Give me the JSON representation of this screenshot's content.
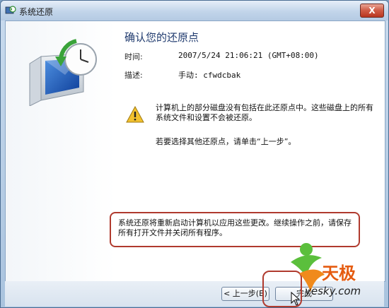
{
  "window": {
    "title": "系统还原",
    "close_label": "X"
  },
  "main": {
    "heading": "确认您的还原点",
    "time_label": "时间:",
    "time_value": "2007/5/24 21:06:21 (GMT+08:00)",
    "desc_label": "描述:",
    "desc_value": "手动: cfwdcbak",
    "notice": "计算机上的部分磁盘没有包括在此还原点中。这些磁盘上的所有系统文件和设置不会被还原。",
    "hint": "若要选择其他还原点，请单击“上一步”。",
    "callout": "系统还原将重新启动计算机以应用这些更改。继续操作之前，请保存所有打开文件并关闭所有程序。"
  },
  "footer": {
    "back_label": "< 上一步(B)",
    "finish_label": "完成"
  },
  "watermark": {
    "cn": "天极",
    "en": "yesky.com"
  },
  "icons": {
    "title": "system-restore-icon",
    "hero": "restore-monitor-clock-icon",
    "warning": "warning-icon",
    "cursor": "mouse-pointer-icon"
  },
  "colors": {
    "heading": "#1f3a6e",
    "highlight": "#b03a2e",
    "watermark": "#e55b10"
  }
}
